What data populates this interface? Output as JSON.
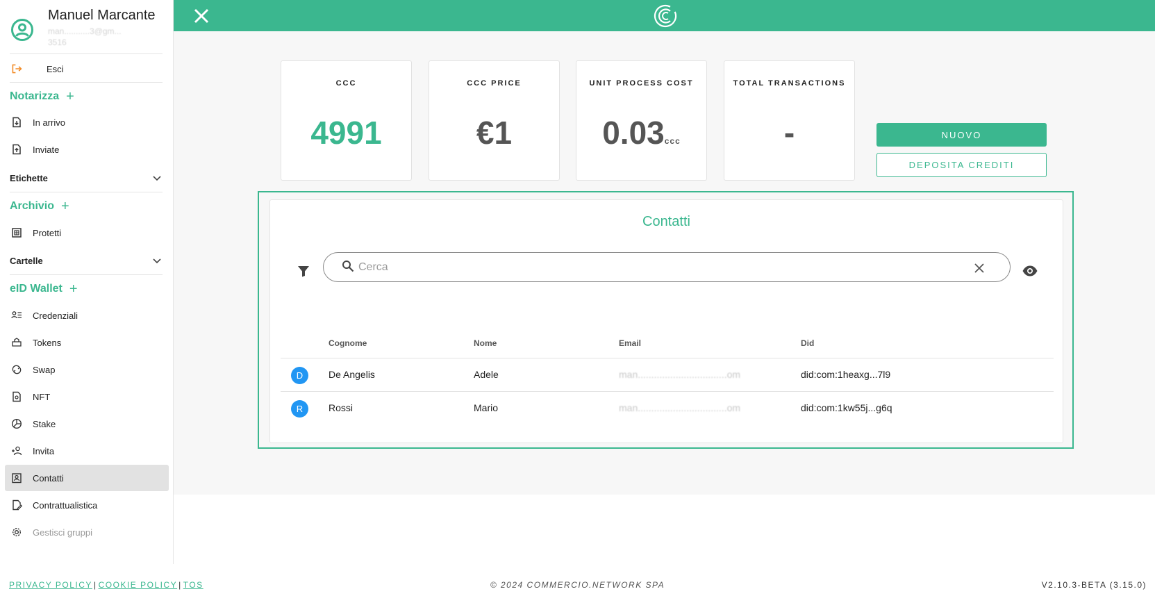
{
  "profile": {
    "name": "Manuel Marcante",
    "email": "man...........3@gm...",
    "phone": "3516"
  },
  "sidebar": {
    "logout": "Esci",
    "notarizza": {
      "title": "Notarizza",
      "plus": "+",
      "items": [
        {
          "label": "In arrivo",
          "icon": "inbox-document-icon"
        },
        {
          "label": "Inviate",
          "icon": "sent-document-icon"
        }
      ]
    },
    "etichette": "Etichette",
    "archivio": {
      "title": "Archivio",
      "plus": "+",
      "items": [
        {
          "label": "Protetti",
          "icon": "protected-box-icon"
        }
      ]
    },
    "cartelle": "Cartelle",
    "wallet": {
      "title": "eID Wallet",
      "plus": "+",
      "items": [
        {
          "label": "Credenziali",
          "icon": "credentials-icon"
        },
        {
          "label": "Tokens",
          "icon": "tokens-icon"
        },
        {
          "label": "Swap",
          "icon": "swap-icon"
        },
        {
          "label": "NFT",
          "icon": "nft-icon"
        },
        {
          "label": "Stake",
          "icon": "stake-icon"
        },
        {
          "label": "Invita",
          "icon": "invite-user-icon"
        },
        {
          "label": "Contatti",
          "icon": "contacts-icon"
        },
        {
          "label": "Contrattualistica",
          "icon": "contract-icon"
        },
        {
          "label": "Gestisci gruppi",
          "icon": "gear-icon"
        }
      ]
    }
  },
  "stats": [
    {
      "label": "CCC",
      "value": "4991",
      "unit": ""
    },
    {
      "label": "CCC PRICE",
      "value": "€1",
      "unit": ""
    },
    {
      "label": "UNIT PROCESS COST",
      "value": "0.03",
      "unit": "ccc"
    },
    {
      "label": "TOTAL TRANSACTIONS",
      "value": "-",
      "unit": ""
    }
  ],
  "actions": {
    "new": "NUOVO",
    "deposit": "DEPOSITA CREDITI"
  },
  "contacts": {
    "title": "Contatti",
    "search_placeholder": "Cerca",
    "columns": [
      "Cognome",
      "Nome",
      "Email",
      "Did"
    ],
    "rows": [
      {
        "initial": "D",
        "surname": "De Angelis",
        "name": "Adele",
        "email": "man.................................om",
        "did": "did:com:1heaxg...7l9"
      },
      {
        "initial": "R",
        "surname": "Rossi",
        "name": "Mario",
        "email": "man.................................om",
        "did": "did:com:1kw55j...g6q"
      }
    ]
  },
  "footer": {
    "privacy": "PRIVACY POLICY",
    "cookie": "COOKIE POLICY",
    "tos": "TOS",
    "separator": "|",
    "copyright": "© 2024 COMMERCIO.NETWORK SPA",
    "version": "V2.10.3-BETA (3.15.0)"
  },
  "colors": {
    "accent": "#3bb78f",
    "avatar_blue": "#2196f3",
    "active_bg": "#e2e2e2"
  }
}
